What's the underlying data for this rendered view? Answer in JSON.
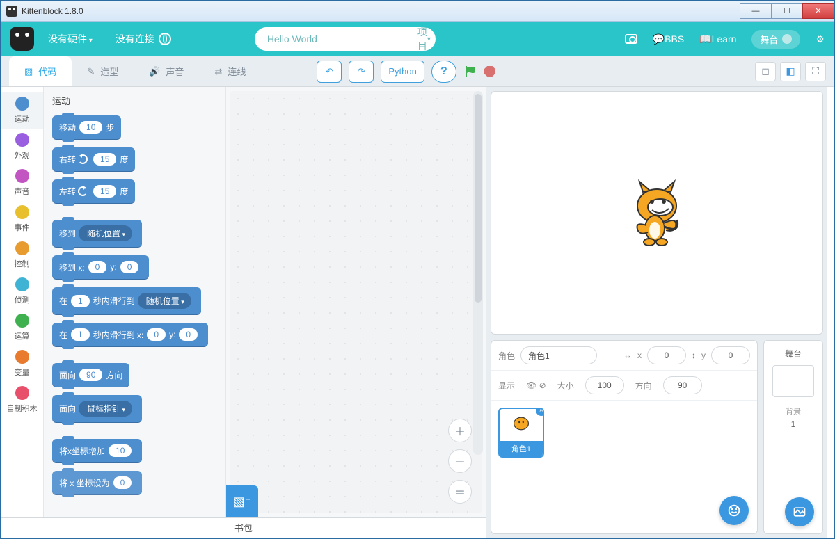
{
  "window": {
    "title": "Kittenblock 1.8.0"
  },
  "menubar": {
    "hardware": "没有硬件",
    "connection": "没有连接",
    "project_name": "Hello World",
    "project_menu": "项目",
    "bbs": "BBS",
    "learn": "Learn",
    "stage_pill": "舞台"
  },
  "tabs": {
    "code": "代码",
    "costumes": "造型",
    "sounds": "声音",
    "wiring": "连线"
  },
  "toolbar": {
    "python": "Python"
  },
  "categories": [
    {
      "label": "运动",
      "color": "#4d8ecf"
    },
    {
      "label": "外观",
      "color": "#9a5fe0"
    },
    {
      "label": "声音",
      "color": "#c355c3"
    },
    {
      "label": "事件",
      "color": "#e8c02e"
    },
    {
      "label": "控制",
      "color": "#e89b2e"
    },
    {
      "label": "侦测",
      "color": "#3fb3d4"
    },
    {
      "label": "运算",
      "color": "#3fb24f"
    },
    {
      "label": "变量",
      "color": "#e87b2e"
    },
    {
      "label": "自制积木",
      "color": "#e84f6a"
    }
  ],
  "palette": {
    "heading": "运动",
    "move": {
      "pre": "移动",
      "val": "10",
      "post": "步"
    },
    "turn_r": {
      "pre": "右转",
      "val": "15",
      "post": "度"
    },
    "turn_l": {
      "pre": "左转",
      "val": "15",
      "post": "度"
    },
    "goto_dd": {
      "pre": "移到",
      "dd": "随机位置"
    },
    "goto_xy": {
      "pre": "移到 x:",
      "x": "0",
      "mid": "y:",
      "y": "0"
    },
    "glide_dd": {
      "pre": "在",
      "sec": "1",
      "mid": "秒内滑行到",
      "dd": "随机位置"
    },
    "glide_xy": {
      "pre": "在",
      "sec": "1",
      "mid": "秒内滑行到 x:",
      "x": "0",
      "mid2": "y:",
      "y": "0"
    },
    "point_dir": {
      "pre": "面向",
      "val": "90",
      "post": "方向"
    },
    "point_to": {
      "pre": "面向",
      "dd": "鼠标指针"
    },
    "change_x": {
      "pre": "将x坐标增加",
      "val": "10"
    },
    "set_x_partial": "将 x 坐标设为"
  },
  "sprite": {
    "label_sprite": "角色",
    "name": "角色1",
    "label_x": "x",
    "x": "0",
    "label_y": "y",
    "y": "0",
    "label_show": "显示",
    "label_size": "大小",
    "size": "100",
    "label_dir": "方向",
    "dir": "90",
    "thumb_name": "角色1"
  },
  "stage_panel": {
    "title": "舞台",
    "bg_label": "背景",
    "bg_count": "1"
  },
  "backpack": "书包"
}
